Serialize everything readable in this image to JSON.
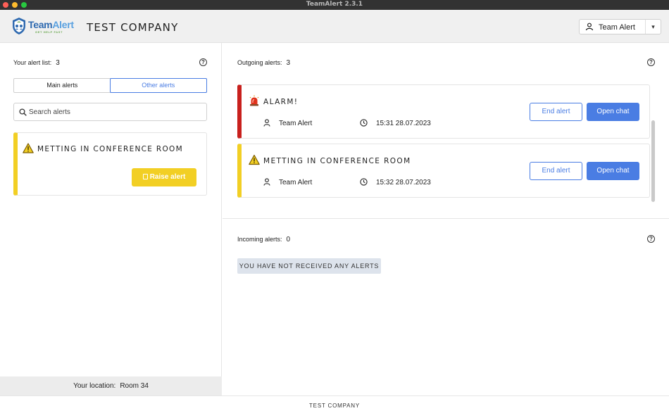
{
  "window": {
    "title": "TeamAlert 2.3.1"
  },
  "header": {
    "logo_text_a": "Team",
    "logo_text_b": "Alert",
    "logo_tagline": "GET HELP FAST",
    "company": "TEST COMPANY",
    "user_select": {
      "value": "Team Alert",
      "caret": "▾"
    }
  },
  "left": {
    "list_label": "Your alert list:",
    "list_count": "3",
    "tabs": [
      {
        "label": "Main alerts",
        "active": false
      },
      {
        "label": "Other alerts",
        "active": true
      }
    ],
    "search_placeholder": "Search alerts",
    "alert_card": {
      "title": "METTING IN CONFERENCE ROOM",
      "icon": "warning-icon",
      "raise_label": "Raise alert",
      "accent": "#f2cf24"
    },
    "location_label": "Your location:",
    "location_value": "Room 34"
  },
  "outgoing": {
    "label": "Outgoing alerts:",
    "count": "3",
    "alerts": [
      {
        "title": "ALARM!",
        "icon": "siren-icon",
        "accent": "#c8201d",
        "sender": "Team Alert",
        "time": "15:31 28.07.2023",
        "end_label": "End alert",
        "chat_label": "Open chat"
      },
      {
        "title": "METTING IN CONFERENCE ROOM",
        "icon": "warning-icon",
        "accent": "#f2cf24",
        "sender": "Team Alert",
        "time": "15:32 28.07.2023",
        "end_label": "End alert",
        "chat_label": "Open chat"
      }
    ]
  },
  "incoming": {
    "label": "Incoming alerts:",
    "count": "0",
    "empty_message": "YOU HAVE NOT RECEIVED ANY ALERTS"
  },
  "help_glyph": "?",
  "footer": {
    "company": "TEST COMPANY"
  },
  "colors": {
    "primary": "#4a7de3",
    "alarm_red": "#c8201d",
    "warning_yellow": "#f2cf24"
  }
}
